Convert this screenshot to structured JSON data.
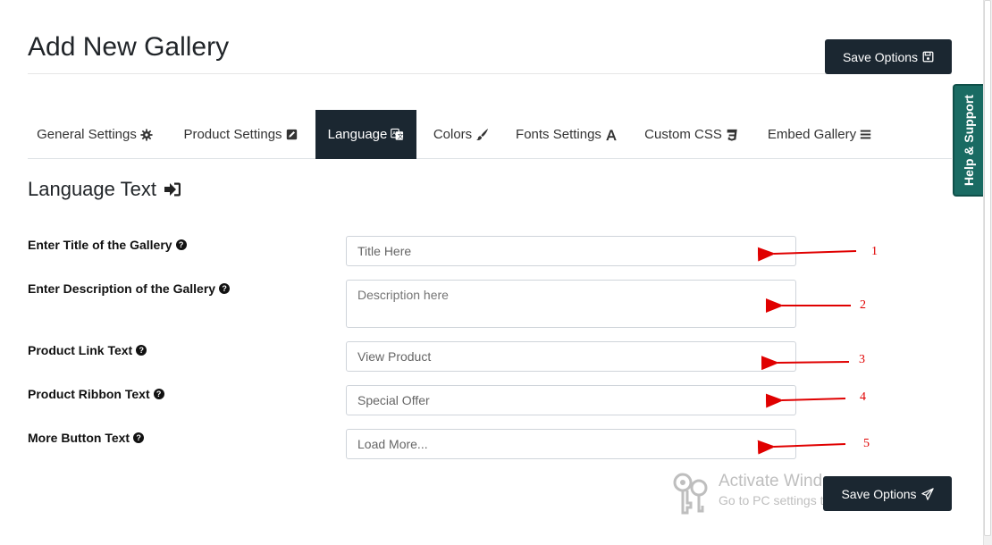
{
  "page": {
    "title": "Add New Gallery"
  },
  "toolbar": {
    "save_label": "Save Options"
  },
  "help_tab": {
    "label": "Help & Support"
  },
  "tabs": [
    {
      "label": "General Settings",
      "icon": "gear-icon"
    },
    {
      "label": "Product Settings",
      "icon": "edit-icon"
    },
    {
      "label": "Language",
      "icon": "language-icon",
      "active": true
    },
    {
      "label": "Colors",
      "icon": "paintbrush-icon"
    },
    {
      "label": "Fonts Settings",
      "icon": "font-icon"
    },
    {
      "label": "Custom CSS",
      "icon": "css3-icon"
    },
    {
      "label": "Embed Gallery",
      "icon": "bars-icon"
    }
  ],
  "section": {
    "heading": "Language Text",
    "icon": "sign-in-icon"
  },
  "fields": [
    {
      "label": "Enter Title of the Gallery",
      "placeholder": "Title Here",
      "annotation": "1"
    },
    {
      "label": "Enter Description of the Gallery",
      "placeholder": "Description here",
      "annotation": "2"
    },
    {
      "label": "Product Link Text",
      "placeholder": "View Product",
      "annotation": "3"
    },
    {
      "label": "Product Ribbon Text",
      "placeholder": "Special Offer",
      "annotation": "4"
    },
    {
      "label": "More Button Text",
      "placeholder": "Load More...",
      "annotation": "5"
    }
  ],
  "watermark": {
    "title": "Activate Windows",
    "subtitle": "Go to PC settings to activate Windows."
  },
  "colors": {
    "dark": "#1b2731",
    "help_tab": "#1a6b63",
    "annotation": "#e00000"
  }
}
